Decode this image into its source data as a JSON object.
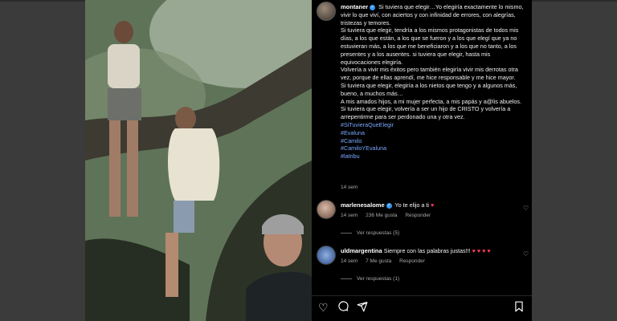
{
  "post": {
    "username": "montaner",
    "caption_paragraphs": [
      "Si tuviera que elegir…Yo elegiría exactamente lo mismo, vivir lo que viví, con aciertos y con infinidad de errores, con alegrías, tristezas y temores.",
      "Si tuviera que elegir, tendría a los mismos protagonistas de todos mis días, a los que están, a los que se fueron y a los que elegí que ya no estuvieran más, a los que me beneficiaron y a los que no tanto, a los presentes y a los ausentes. si tuviera que elegir, hasta mis equivocaciones elegiría.",
      "Volvería a vivir mis éxitos pero también elegiría vivir mis derrotas otra vez, porque de ellas aprendí, me hice responsable y me hice mayor.",
      "Si tuviera que elegir, elegiría a los nietos que tengo y a algunos más, bueno, a muchos más…",
      "A mis amados hijos, a mi mujer perfecta, a mis papás y a@lis abuelos.",
      "Si tuviera que elegir, volvería a ser un hijo de CRISTO y volvería a arrepentirme para ser perdonado una y otra vez."
    ],
    "hashtags": [
      "#SiTuvieraQueElegir",
      "#Evaluna",
      "#Camilo",
      "#CamiloYEvaluna",
      "#latribu"
    ],
    "time": "14 sem"
  },
  "comments": [
    {
      "username": "marlenesalome",
      "text": "Yo te elijo a ti",
      "emoji": "♥",
      "time": "14 sem",
      "likes": "236 Me gusta",
      "reply_label": "Responder",
      "replies_label": "Ver respuestas (5)"
    },
    {
      "username": "uldmargentina",
      "text": "Siempre con las palabras justas!!!",
      "emoji": "♥ ♥ ♥ ♥",
      "time": "14 sem",
      "likes": "7 Me gusta",
      "reply_label": "Responder",
      "replies_label": "Ver respuestas (1)"
    }
  ],
  "actions": {
    "like_icon": "heart-outline-icon",
    "comment_icon": "comment-bubble-icon",
    "share_icon": "paper-plane-icon",
    "save_icon": "bookmark-icon"
  },
  "colors": {
    "background": "#000000",
    "hashtag": "#7aa8ff",
    "verified": "#3897f0",
    "heart": "#ff3b5c"
  }
}
